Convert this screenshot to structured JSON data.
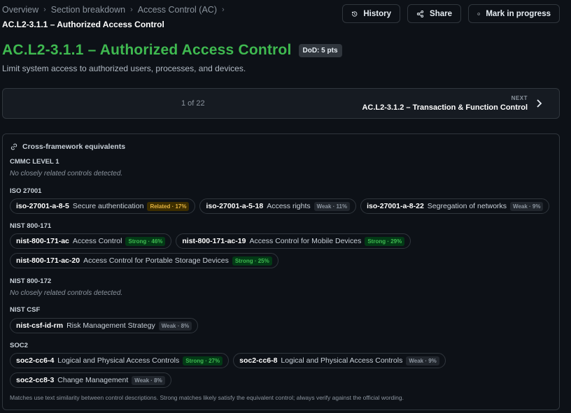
{
  "breadcrumb": {
    "items": [
      "Overview",
      "Section breakdown",
      "Access Control (AC)"
    ],
    "current": "AC.L2-3.1.1 – Authorized Access Control"
  },
  "actions": {
    "history": "History",
    "share": "Share",
    "mark_progress": "Mark in progress"
  },
  "header": {
    "title": "AC.L2-3.1.1 – Authorized Access Control",
    "dod_badge": "DoD: 5 pts",
    "subtitle": "Limit system access to authorized users, processes, and devices."
  },
  "pager": {
    "count": "1 of 22",
    "next_label": "NEXT",
    "next_title": "AC.L2-3.1.2 – Transaction & Function Control"
  },
  "crossframework": {
    "heading": "Cross-framework equivalents",
    "groups": [
      {
        "label": "CMMC LEVEL 1",
        "empty": "No closely related controls detected.",
        "rows": []
      },
      {
        "label": "ISO 27001",
        "rows": [
          [
            {
              "id": "iso-27001-a-8-5",
              "name": "Secure authentication",
              "badge": "Related · 17%",
              "kind": "related"
            },
            {
              "id": "iso-27001-a-5-18",
              "name": "Access rights",
              "badge": "Weak · 11%",
              "kind": "weak"
            },
            {
              "id": "iso-27001-a-8-22",
              "name": "Segregation of networks",
              "badge": "Weak · 9%",
              "kind": "weak"
            }
          ]
        ]
      },
      {
        "label": "NIST 800-171",
        "rows": [
          [
            {
              "id": "nist-800-171-ac",
              "name": "Access Control",
              "badge": "Strong · 46%",
              "kind": "strong"
            },
            {
              "id": "nist-800-171-ac-19",
              "name": "Access Control for Mobile Devices",
              "badge": "Strong · 29%",
              "kind": "strong"
            }
          ],
          [
            {
              "id": "nist-800-171-ac-20",
              "name": "Access Control for Portable Storage Devices",
              "badge": "Strong · 25%",
              "kind": "strong"
            }
          ]
        ]
      },
      {
        "label": "NIST 800-172",
        "empty": "No closely related controls detected.",
        "rows": []
      },
      {
        "label": "NIST CSF",
        "rows": [
          [
            {
              "id": "nist-csf-id-rm",
              "name": "Risk Management Strategy",
              "badge": "Weak · 8%",
              "kind": "weak"
            }
          ]
        ]
      },
      {
        "label": "SOC2",
        "rows": [
          [
            {
              "id": "soc2-cc6-4",
              "name": "Logical and Physical Access Controls",
              "badge": "Strong · 27%",
              "kind": "strong"
            },
            {
              "id": "soc2-cc6-8",
              "name": "Logical and Physical Access Controls",
              "badge": "Weak · 9%",
              "kind": "weak"
            }
          ],
          [
            {
              "id": "soc2-cc8-3",
              "name": "Change Management",
              "badge": "Weak · 8%",
              "kind": "weak"
            }
          ]
        ]
      }
    ],
    "footnote": "Matches use text similarity between control descriptions. Strong matches likely satisfy the equivalent control; always verify against the official wording."
  },
  "colors": {
    "title_green": "#3fb950",
    "background": "#0d1117",
    "related": "#e3b341",
    "strong": "#3fb950",
    "weak": "#8b949e"
  },
  "icons": [
    "history-icon",
    "share-icon",
    "check-circle-icon",
    "chevron-right-icon",
    "link-icon"
  ]
}
